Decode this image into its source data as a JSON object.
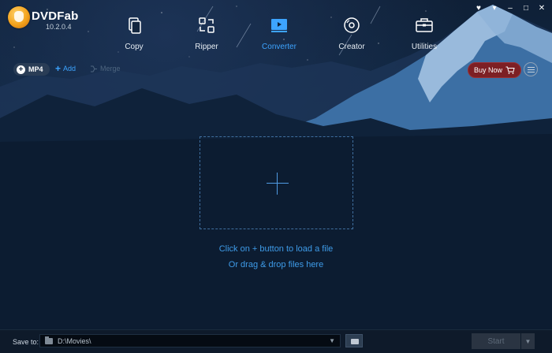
{
  "app": {
    "name": "DVDFab",
    "version": "10.2.0.4"
  },
  "window_controls": [
    {
      "icon": "heart-icon",
      "glyph": "♥"
    },
    {
      "icon": "dropdown-icon",
      "glyph": "▾"
    },
    {
      "icon": "minimize-icon",
      "glyph": "–"
    },
    {
      "icon": "maximize-icon",
      "glyph": "□"
    },
    {
      "icon": "close-icon",
      "glyph": "✕"
    }
  ],
  "nav": {
    "items": [
      {
        "label": "Copy",
        "icon": "copy-icon",
        "active": false
      },
      {
        "label": "Ripper",
        "icon": "ripper-icon",
        "active": false
      },
      {
        "label": "Converter",
        "icon": "converter-icon",
        "active": true
      },
      {
        "label": "Creator",
        "icon": "creator-disc-icon",
        "active": false
      },
      {
        "label": "Utilities",
        "icon": "utilities-toolbox-icon",
        "active": false
      }
    ]
  },
  "toolbar": {
    "profile_label": "MP4",
    "add_label": "Add",
    "merge_label": "Merge",
    "buy_label": "Buy Now"
  },
  "dropzone": {
    "hint_line1": "Click on + button to load a file",
    "hint_line2": "Or drag & drop files here"
  },
  "bottom": {
    "save_label": "Save to:",
    "save_path": "D:\\Movies\\",
    "start_label": "Start"
  },
  "colors": {
    "accent": "#3da4ff",
    "buy_button": "#7d1f24",
    "background": "#0b1a2f"
  }
}
